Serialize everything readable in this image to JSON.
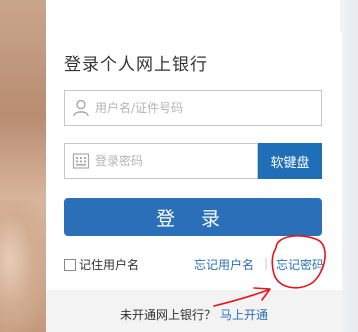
{
  "login": {
    "title": "登录个人网上银行",
    "username_placeholder": "用户名/证件号码",
    "password_placeholder": "登录密码",
    "softkey_label": "软键盘",
    "login_label": "登 录",
    "remember_label": "记住用户名",
    "forgot_user_label": "忘记用户名",
    "separator": "|",
    "forgot_pwd_label": "忘记密码",
    "no_account_text": "未开通网上银行？",
    "open_now_label": "马上开通"
  },
  "colors": {
    "accent": "#2b6fb8",
    "annotation": "#e8141c"
  },
  "icons": {
    "user": "user-icon",
    "password": "keypad-icon"
  }
}
